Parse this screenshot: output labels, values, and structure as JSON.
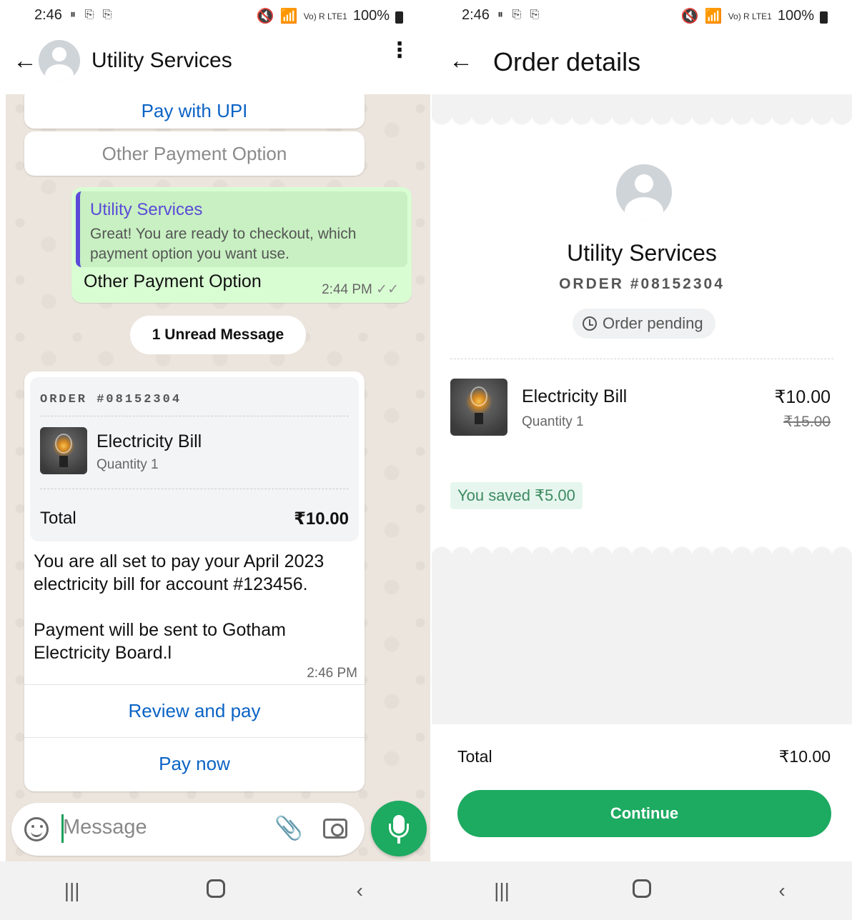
{
  "status": {
    "left_time": "2:46",
    "right_time": "2:46",
    "battery": "100%",
    "network": "Vo) R LTE1"
  },
  "chat": {
    "back_icon": "arrow-left-icon",
    "title": "Utility Services",
    "menu_icon": "more-vertical-icon",
    "pay_upi": "Pay with UPI",
    "other_payment": "Other Payment Option",
    "quote_title": "Utility Services",
    "quote_body": "Great! You are ready to checkout, which payment option you want use.",
    "out_message": "Other Payment Option",
    "out_time": "2:44 PM",
    "unread": "1 Unread Message",
    "order": {
      "order_no": "ORDER #08152304",
      "item_name": "Electricity Bill",
      "item_qty": "Quantity 1",
      "total_label": "Total",
      "total_value": "₹10.00",
      "message_line1": "You are all set to pay your April 2023 electricity bill for account #123456.",
      "message_line2": "Payment will be sent to Gotham Electricity Board.l",
      "time": "2:46 PM",
      "review": "Review and pay",
      "pay_now": "Pay now"
    },
    "input_placeholder": "Message"
  },
  "order_details": {
    "title": "Order details",
    "merchant": "Utility Services",
    "order_no": "ORDER #08152304",
    "status": "Order pending",
    "item_name": "Electricity Bill",
    "item_qty": "Quantity 1",
    "price": "₹10.00",
    "old_price": "₹15.00",
    "saved": "You saved ₹5.00",
    "total_label": "Total",
    "total_value": "₹10.00",
    "continue": "Continue"
  },
  "colors": {
    "accent_green": "#1daa61",
    "link_blue": "#0b63c5",
    "quote_purple": "#5b4ad8",
    "chat_bg": "#ece5dd",
    "outgoing_bubble": "#d9fdd3"
  }
}
